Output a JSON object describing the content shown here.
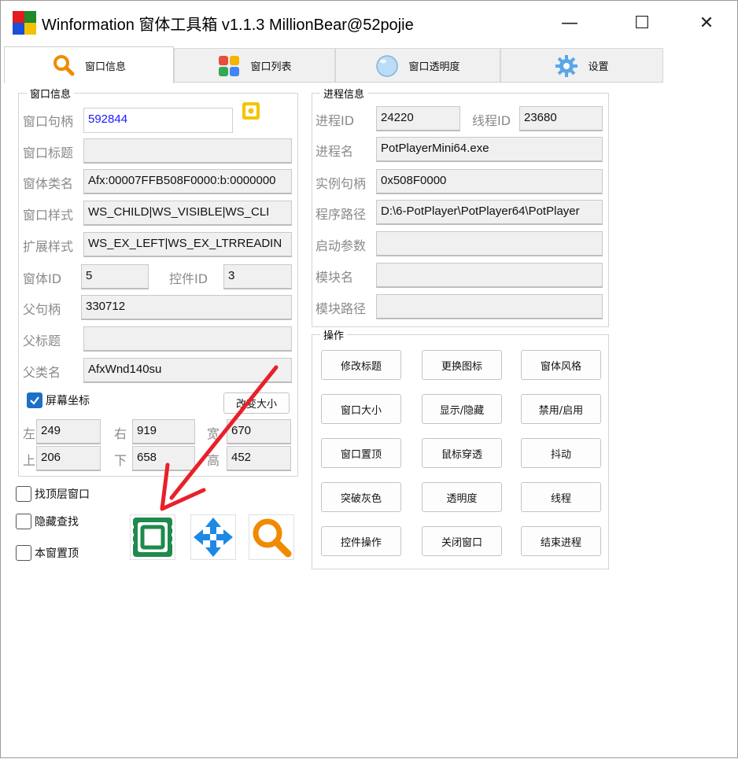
{
  "window": {
    "title": "Winformation 窗体工具箱 v1.1.3  MillionBear@52pojie",
    "minimize": "—",
    "maximize": "☐",
    "close": "✕"
  },
  "tabs": [
    {
      "label": "窗口信息",
      "icon": "magnifier-icon",
      "active": true
    },
    {
      "label": "窗口列表",
      "icon": "color-grid-icon",
      "active": false
    },
    {
      "label": "窗口透明度",
      "icon": "bubble-icon",
      "active": false
    },
    {
      "label": "设置",
      "icon": "gear-icon",
      "active": false
    }
  ],
  "window_info": {
    "group_title": "窗口信息",
    "handle_label": "窗口句柄",
    "handle_value": "592844",
    "title_label": "窗口标题",
    "title_value": "",
    "class_label": "窗体类名",
    "class_value": "Afx:00007FFB508F0000:b:0000000",
    "style_label": "窗口样式",
    "style_value": "WS_CHILD|WS_VISIBLE|WS_CLI",
    "exstyle_label": "扩展样式",
    "exstyle_value": "WS_EX_LEFT|WS_EX_LTRREADIN",
    "form_id_label": "窗体ID",
    "form_id_value": "5",
    "control_id_label": "控件ID",
    "control_id_value": "3",
    "parent_handle_label": "父句柄",
    "parent_handle_value": "330712",
    "parent_title_label": "父标题",
    "parent_title_value": "",
    "parent_class_label": "父类名",
    "parent_class_value": "AfxWnd140su",
    "screen_coords_label": "屏幕坐标",
    "screen_coords_checked": true,
    "resize_button": "改变大小",
    "left_label": "左",
    "left_value": "249",
    "right_label": "右",
    "right_value": "919",
    "width_label": "宽",
    "width_value": "670",
    "top_label": "上",
    "top_value": "206",
    "bottom_label": "下",
    "bottom_value": "658",
    "height_label": "高",
    "height_value": "452"
  },
  "options": {
    "find_top_window": "找顶层窗口",
    "hide_find": "隐藏查找",
    "stay_on_top": "本窗置顶"
  },
  "process_info": {
    "group_title": "进程信息",
    "pid_label": "进程ID",
    "pid_value": "24220",
    "tid_label": "线程ID",
    "tid_value": "23680",
    "name_label": "进程名",
    "name_value": "PotPlayerMini64.exe",
    "instance_label": "实例句柄",
    "instance_value": "0x508F0000",
    "path_label": "程序路径",
    "path_value": "D:\\6-PotPlayer\\PotPlayer64\\PotPlayer",
    "args_label": "启动参数",
    "args_value": "",
    "module_label": "模块名",
    "module_value": "",
    "module_path_label": "模块路径",
    "module_path_value": ""
  },
  "operations": {
    "group_title": "操作",
    "buttons": [
      "修改标题",
      "更换图标",
      "窗体风格",
      "窗口大小",
      "显示/隐藏",
      "禁用/启用",
      "窗口置顶",
      "鼠标穿透",
      "抖动",
      "突破灰色",
      "透明度",
      "线程",
      "控件操作",
      "关闭窗口",
      "结束进程"
    ]
  },
  "colors": {
    "arrow": "#e8202a",
    "accent": "#1e6fc6",
    "tool_green": "#1f8a4c",
    "tool_blue": "#1e88e5",
    "tool_orange": "#f08a00"
  }
}
